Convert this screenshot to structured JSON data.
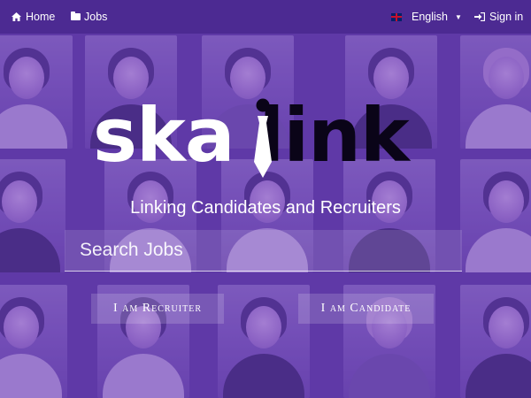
{
  "nav": {
    "home_label": "Home",
    "jobs_label": "Jobs",
    "language_label": "English",
    "signin_label": "Sign in"
  },
  "hero": {
    "logo_part1": "ska",
    "logo_part2": "link",
    "tagline": "Linking Candidates and Recruiters",
    "search_placeholder": "Search Jobs",
    "recruiter_button": "I am Recruiter",
    "candidate_button": "I am Candidate"
  },
  "icons": {
    "home": "home-icon",
    "jobs": "folder-icon",
    "language": "uk-flag-icon",
    "signin": "sign-in-icon"
  },
  "colors": {
    "topbar": "#4c2a92",
    "overlay": "#6a3fb3",
    "logo_white": "#ffffff",
    "logo_dark": "#0a0418"
  }
}
